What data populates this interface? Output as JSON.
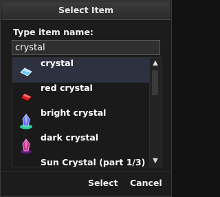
{
  "dialog": {
    "title": "Select Item",
    "prompt": "Type item name:",
    "search_value": "crystal"
  },
  "items": [
    {
      "label": "crystal",
      "icon": "crystal-icon",
      "selected": true,
      "color": "#6fc7ff"
    },
    {
      "label": "red crystal",
      "icon": "red-crystal-icon",
      "selected": false,
      "color": "#e02a2a"
    },
    {
      "label": "bright crystal",
      "icon": "bright-crystal-icon",
      "selected": false,
      "color": "#5b6cff"
    },
    {
      "label": "dark crystal",
      "icon": "dark-crystal-icon",
      "selected": false,
      "color": "#c0308f"
    },
    {
      "label": "Sun Crystal (part 1/3)",
      "icon": "sun-crystal-icon",
      "selected": false
    }
  ],
  "buttons": {
    "select": "Select",
    "cancel": "Cancel"
  },
  "colors": {
    "selected_row": "#2d3140",
    "background": "#1c1c1c"
  }
}
